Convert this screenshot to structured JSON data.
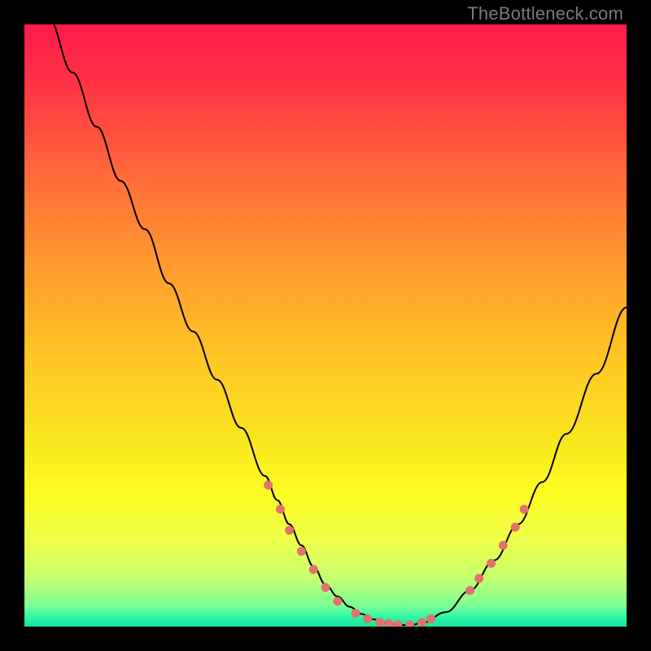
{
  "branding": "TheBottleneck.com",
  "colors": {
    "curve_stroke": "#000000",
    "marker_fill": "#e2726c",
    "marker_stroke": "#e2726c"
  },
  "gradient_stops": [
    {
      "offset": 0.0,
      "color": "#ff1b4b"
    },
    {
      "offset": 0.1,
      "color": "#ff3345"
    },
    {
      "offset": 0.25,
      "color": "#ff6a3a"
    },
    {
      "offset": 0.4,
      "color": "#ff9a2f"
    },
    {
      "offset": 0.55,
      "color": "#ffc524"
    },
    {
      "offset": 0.7,
      "color": "#f9e81e"
    },
    {
      "offset": 0.78,
      "color": "#fdfc23"
    },
    {
      "offset": 0.86,
      "color": "#ecff4a"
    },
    {
      "offset": 0.92,
      "color": "#c4ff70"
    },
    {
      "offset": 0.965,
      "color": "#7bff96"
    },
    {
      "offset": 0.985,
      "color": "#2cf6a7"
    },
    {
      "offset": 1.0,
      "color": "#18e39b"
    }
  ],
  "chart_data": {
    "type": "line",
    "title": "",
    "xlabel": "",
    "ylabel": "",
    "xlim": [
      0,
      100
    ],
    "ylim": [
      0,
      100
    ],
    "x": [
      0,
      4,
      8,
      12,
      16,
      20,
      24,
      28,
      32,
      36,
      40,
      42,
      44,
      46,
      48,
      50,
      52,
      54,
      56,
      58,
      60,
      62,
      64,
      66,
      70,
      74,
      78,
      82,
      86,
      90,
      95,
      100
    ],
    "values": [
      110,
      101,
      92,
      83,
      74,
      66,
      57,
      49,
      41,
      33,
      25,
      21,
      17,
      13.5,
      10,
      7,
      5,
      3.3,
      2.1,
      1.2,
      0.6,
      0.3,
      0.2,
      0.6,
      2.4,
      6.0,
      11.0,
      17.0,
      24.0,
      32.0,
      42.0,
      53.0
    ],
    "markers": [
      {
        "x": 40.5,
        "y": 23.5
      },
      {
        "x": 42.5,
        "y": 19.5
      },
      {
        "x": 44.0,
        "y": 16.0
      },
      {
        "x": 46.0,
        "y": 12.5
      },
      {
        "x": 48.0,
        "y": 9.5
      },
      {
        "x": 50.0,
        "y": 6.5
      },
      {
        "x": 52.0,
        "y": 4.2
      },
      {
        "x": 55.0,
        "y": 2.2
      },
      {
        "x": 57.0,
        "y": 1.3
      },
      {
        "x": 59.0,
        "y": 0.7
      },
      {
        "x": 60.5,
        "y": 0.5
      },
      {
        "x": 62.0,
        "y": 0.3
      },
      {
        "x": 64.0,
        "y": 0.3
      },
      {
        "x": 66.0,
        "y": 0.7
      },
      {
        "x": 67.5,
        "y": 1.3
      },
      {
        "x": 74.0,
        "y": 6.0
      },
      {
        "x": 75.5,
        "y": 8.0
      },
      {
        "x": 77.5,
        "y": 10.5
      },
      {
        "x": 79.5,
        "y": 13.5
      },
      {
        "x": 81.5,
        "y": 16.5
      },
      {
        "x": 83.0,
        "y": 19.5
      }
    ],
    "marker_size_px": 10
  }
}
